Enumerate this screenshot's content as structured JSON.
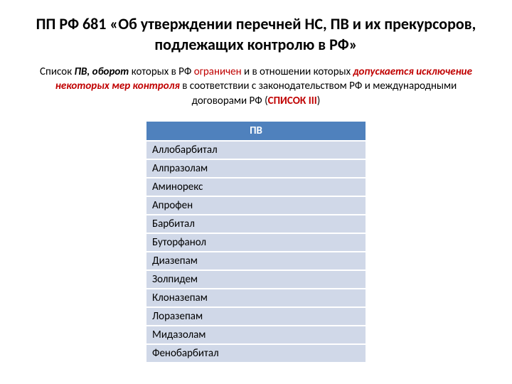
{
  "title": "ПП РФ 681 «Об утверждении перечней НС, ПВ и их прекурсоров, подлежащих контролю в РФ»",
  "subtitle": {
    "t1": "Список ",
    "t2": "ПВ, оборот",
    "t3": " которых в РФ ",
    "t4": "ограничен",
    "t5": " и в отношении которых ",
    "t6": "допускается исключение некоторых мер контроля",
    "t7": " в соответствии с законодательством РФ и международными договорами РФ (",
    "t8": "СПИСОК III",
    "t9": ")"
  },
  "tableHeader": "ПВ",
  "rows": [
    "Аллобарбитал",
    "Алпразолам",
    "Аминорекс",
    "Апрофен",
    "Барбитал",
    "Буторфанол",
    "Диазепам",
    "Золпидем",
    "Клоназепам",
    "Лоразепам",
    "Мидазолам",
    "Фенобарбитал"
  ]
}
